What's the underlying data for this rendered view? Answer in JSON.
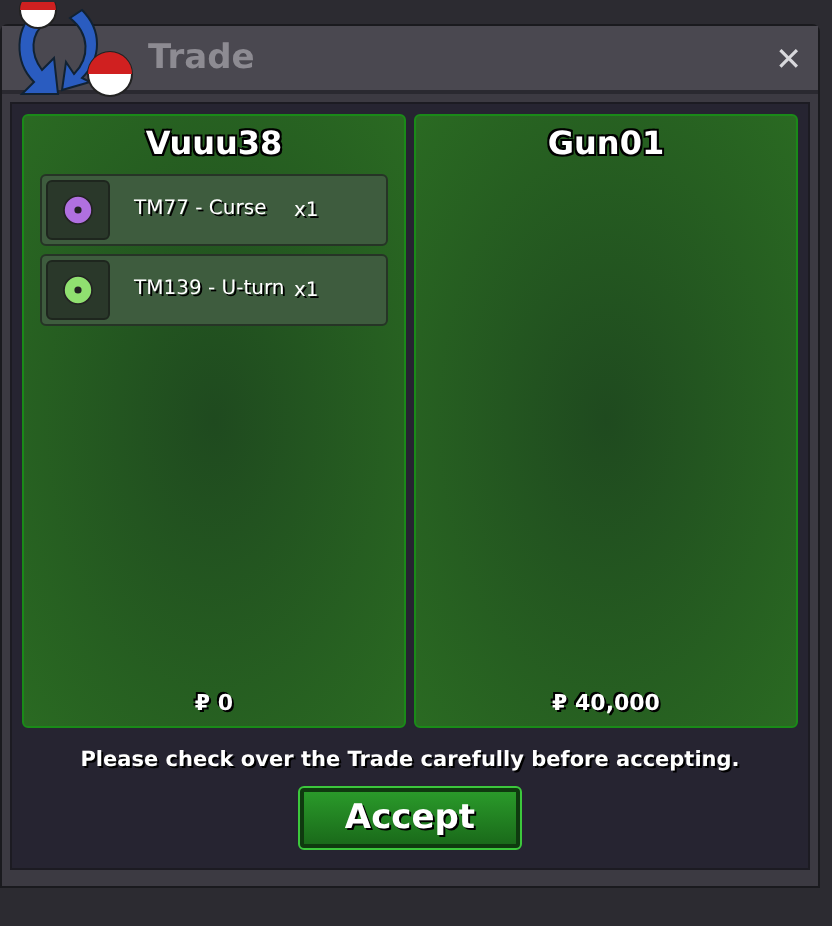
{
  "window": {
    "title": "Trade",
    "close": "✕"
  },
  "panels": [
    {
      "player": "Vuuu38",
      "items": [
        {
          "name": "TM77 - Curse",
          "quantity": "x1",
          "color": "#b070e0"
        },
        {
          "name": "TM139 - U-turn",
          "quantity": "x1",
          "color": "#90e070"
        }
      ],
      "money": "₽ 0"
    },
    {
      "player": "Gun01",
      "money": "₽ 40,000"
    }
  ],
  "notice": "Please check over the Trade carefully before accepting.",
  "button": "Accept"
}
